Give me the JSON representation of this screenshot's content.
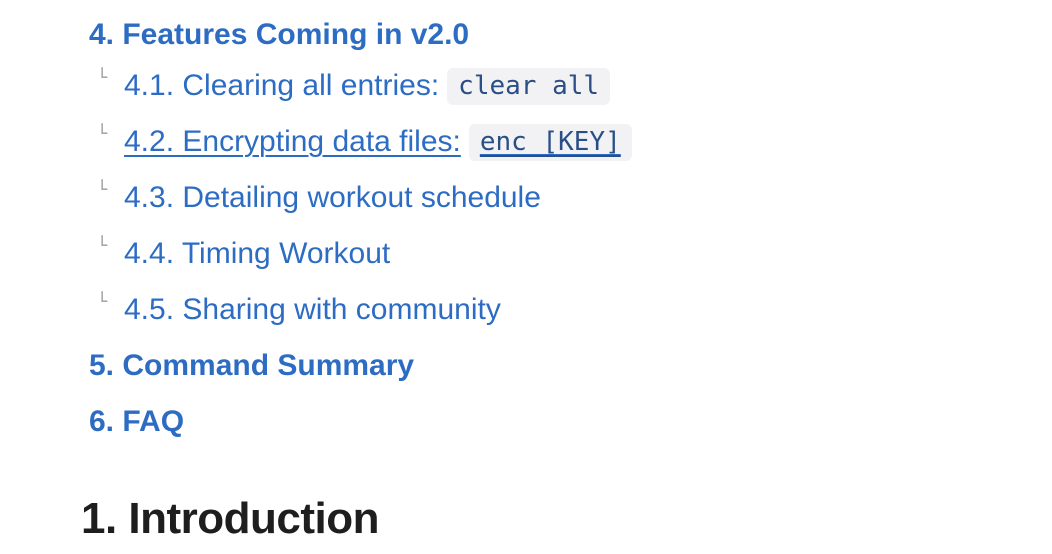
{
  "toc": {
    "sections": [
      {
        "label": "4. Features Coming in v2.0"
      },
      {
        "label": "4.1. Clearing all entries: ",
        "code": "clear all",
        "branch": "└"
      },
      {
        "label": "4.2. Encrypting data files: ",
        "code": "enc [KEY]",
        "branch": "└"
      },
      {
        "label": "4.3. Detailing workout schedule",
        "branch": "└"
      },
      {
        "label": "4.4. Timing Workout",
        "branch": "└"
      },
      {
        "label": "4.5. Sharing with community",
        "branch": "└"
      },
      {
        "label": "5. Command Summary"
      },
      {
        "label": "6. FAQ"
      }
    ]
  },
  "content": {
    "heading": "1. Introduction"
  },
  "colors": {
    "link": "#2d6cc3",
    "code_bg": "#f2f2f4",
    "code_text": "#2a4f86",
    "heading": "#1e1e1e",
    "branch": "#9a9a9a"
  }
}
